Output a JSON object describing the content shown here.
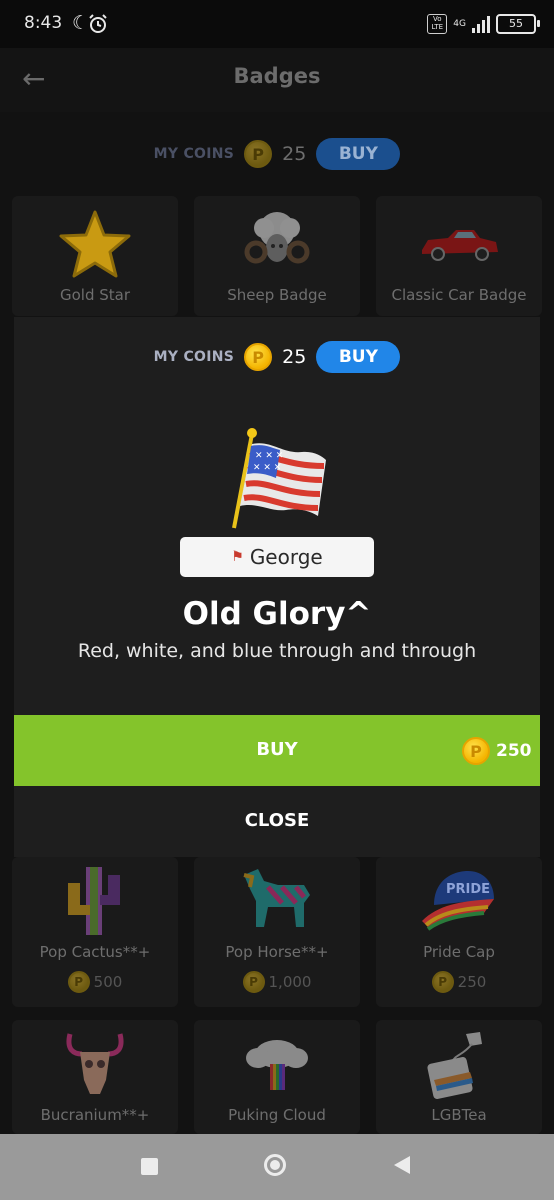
{
  "status_bar": {
    "time": "8:43",
    "network": "4G",
    "volte": "Vo LTE",
    "battery": "55"
  },
  "header": {
    "title": "Badges"
  },
  "coins": {
    "label": "MY COINS",
    "count": "25",
    "buy_label": "BUY"
  },
  "grid": {
    "top_row": [
      {
        "label": "Gold Star"
      },
      {
        "label": "Sheep Badge"
      },
      {
        "label": "Classic Car Badge"
      }
    ],
    "middle_row": [
      {
        "label": "Pop Cactus**+",
        "price": "500"
      },
      {
        "label": "Pop Horse**+",
        "price": "1,000"
      },
      {
        "label": "Pride Cap",
        "price": "250"
      }
    ],
    "bottom_row": [
      {
        "label": "Bucranium**+"
      },
      {
        "label": "Puking Cloud"
      },
      {
        "label": "LGBTea"
      }
    ]
  },
  "modal": {
    "coins_label": "MY COINS",
    "coins_count": "25",
    "buy_coins_label": "BUY",
    "name_chip": "George",
    "badge_title": "Old Glory^",
    "badge_description": "Red, white, and blue through and through",
    "buy_label": "BUY",
    "price": "250",
    "close_label": "CLOSE"
  },
  "colors": {
    "buy_green": "#84c42b",
    "buy_blue": "#2186e8",
    "coin_gold": "#f4b400"
  }
}
